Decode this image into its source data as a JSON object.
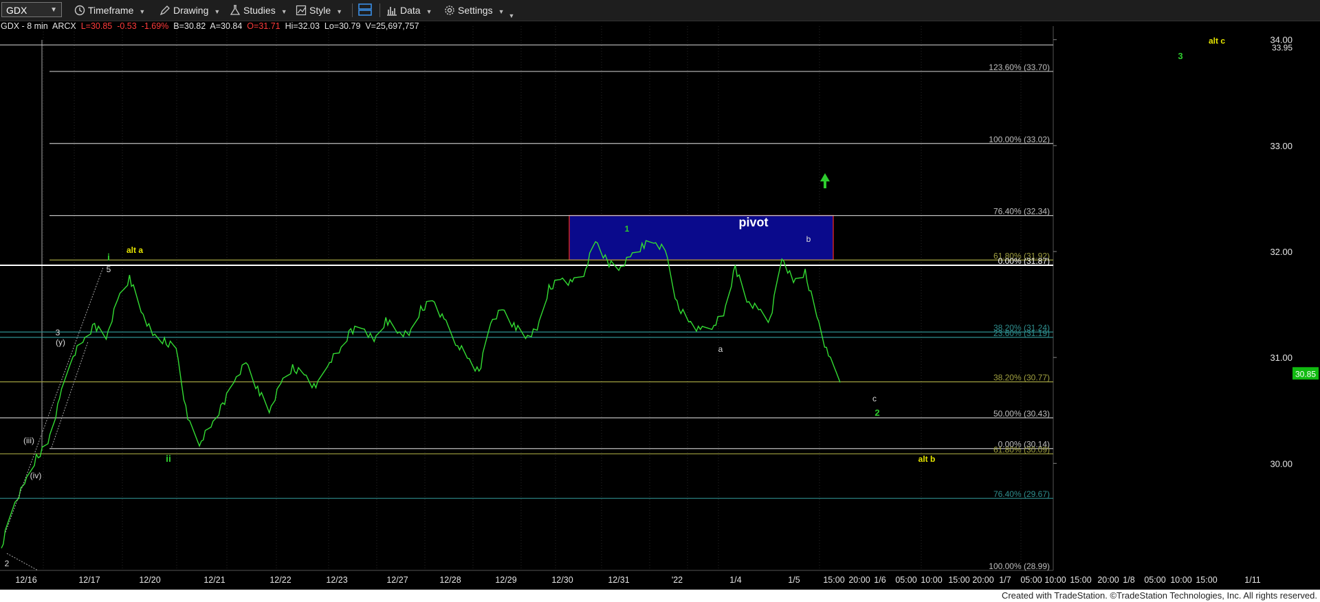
{
  "toolbar": {
    "symbol": "GDX",
    "items": [
      "Timeframe",
      "Drawing",
      "Studies",
      "Style",
      "Data",
      "Settings"
    ]
  },
  "quote": {
    "symbol_interval": "GDX - 8 min",
    "exchange": "ARCX",
    "last": "L=30.85",
    "change": "-0.53",
    "change_pct": "-1.69%",
    "bid": "B=30.82",
    "ask": "A=30.84",
    "open": "O=31.71",
    "high": "Hi=32.03",
    "low": "Lo=30.79",
    "volume": "V=25,697,757"
  },
  "colors": {
    "price_line": "#33dd33",
    "pivot_box": "#0a0a8c",
    "pivot_border": "#cc2222",
    "last_price_bg": "#11bb11",
    "wave_green": "#2ecc2e",
    "wave_yellow": "#e6e600",
    "fib_gray": "#bfbfbf",
    "fib_olive": "#a0a040",
    "fib_teal": "#2f8f8f"
  },
  "chart_data": {
    "type": "line",
    "title": "",
    "ylim": [
      28.99,
      34.05
    ],
    "y_ticks": [
      30.0,
      31.0,
      32.0,
      33.0,
      34.0
    ],
    "y_tick_labels": [
      "30.00",
      "31.00",
      "32.00",
      "33.00",
      "34.00"
    ],
    "last_price": "30.85",
    "top_price_label": "33.95",
    "x_tick_labels": [
      "12/16",
      "12/17",
      "12/20",
      "12/21",
      "12/22",
      "12/23",
      "12/27",
      "12/28",
      "12/29",
      "12/30",
      "12/31",
      "'22",
      "1/4",
      "1/5",
      "15:00",
      "20:00",
      "1/6",
      "05:00",
      "10:00",
      "15:00",
      "20:00",
      "1/7",
      "05:00",
      "10:00",
      "15:00",
      "20:00",
      "1/8",
      "05:00",
      "10:00",
      "15:00",
      "1/11"
    ],
    "series": [
      {
        "values": [
          29.2,
          29.6,
          29.8,
          30.05,
          30.2,
          30.6,
          31.0,
          31.15,
          31.3,
          31.2,
          31.55,
          31.75,
          31.45,
          31.2,
          31.15,
          31.1,
          30.4,
          30.2,
          30.35,
          30.55,
          30.8,
          30.95,
          30.7,
          30.5,
          30.75,
          30.9,
          30.85,
          30.7,
          30.95,
          31.05,
          31.25,
          31.3,
          31.15,
          31.35,
          31.25,
          31.2,
          31.45,
          31.55,
          31.35,
          31.15,
          31.0,
          30.85,
          31.35,
          31.45,
          31.3,
          31.2,
          31.25,
          31.65,
          31.75,
          31.7,
          31.8,
          32.1,
          31.9,
          31.85,
          31.95,
          32.05,
          32.1,
          32.0,
          31.5,
          31.35,
          31.25,
          31.3,
          31.4,
          31.85,
          31.55,
          31.45,
          31.35,
          31.95,
          31.7,
          31.8,
          31.4,
          31.0,
          30.8
        ]
      }
    ],
    "levels": [
      {
        "label": "123.60% (33.70)",
        "value": 33.7,
        "color": "#bfbfbf"
      },
      {
        "label": "100.00% (33.02)",
        "value": 33.02,
        "color": "#bfbfbf"
      },
      {
        "label": "76.40% (32.34)",
        "value": 32.34,
        "color": "#bfbfbf"
      },
      {
        "label": "61.80% (31.92)",
        "value": 31.92,
        "color": "#a0a040"
      },
      {
        "label": "0.00% (31.87)",
        "value": 31.87,
        "color": "#ffffff"
      },
      {
        "label": "38.20% (31.24)",
        "value": 31.24,
        "color": "#2f8f8f"
      },
      {
        "label": "23.60% (31.19)",
        "value": 31.19,
        "color": "#2f8f8f"
      },
      {
        "label": "38.20% (30.77)",
        "value": 30.77,
        "color": "#a0a040"
      },
      {
        "label": "50.00% (30.43)",
        "value": 30.43,
        "color": "#bfbfbf"
      },
      {
        "label": "0.00% (30.14)",
        "value": 30.14,
        "color": "#bfbfbf"
      },
      {
        "label": "61.80% (30.09)",
        "value": 30.09,
        "color": "#a0a040"
      },
      {
        "label": "76.40% (29.67)",
        "value": 29.67,
        "color": "#2f8f8f"
      },
      {
        "label": "100.00% (28.99)",
        "value": 28.99,
        "color": "#bfbfbf"
      }
    ],
    "pivot": {
      "label": "pivot",
      "low": 31.92,
      "high": 32.34
    },
    "annotations": [
      {
        "text": "alt c",
        "color": "#e6e600"
      },
      {
        "text": "3",
        "color": "#2ecc2e"
      },
      {
        "text": "alt a",
        "color": "#e6e600"
      },
      {
        "text": "i",
        "color": "#2ecc2e"
      },
      {
        "text": "5",
        "color": "#dddddd"
      },
      {
        "text": "3",
        "color": "#dddddd"
      },
      {
        "text": "(y)",
        "color": "#dddddd"
      },
      {
        "text": "(iii)",
        "color": "#dddddd"
      },
      {
        "text": "(iv)",
        "color": "#dddddd"
      },
      {
        "text": "2",
        "color": "#dddddd"
      },
      {
        "text": "ii",
        "color": "#2ecc2e"
      },
      {
        "text": "1",
        "color": "#2ecc2e"
      },
      {
        "text": "a",
        "color": "#dddddd"
      },
      {
        "text": "b",
        "color": "#dddddd"
      },
      {
        "text": "c",
        "color": "#dddddd"
      },
      {
        "text": "2",
        "color": "#2ecc2e"
      },
      {
        "text": "alt b",
        "color": "#e6e600"
      }
    ]
  },
  "footer": "Created with TradeStation. ©TradeStation Technologies, Inc. All rights reserved."
}
